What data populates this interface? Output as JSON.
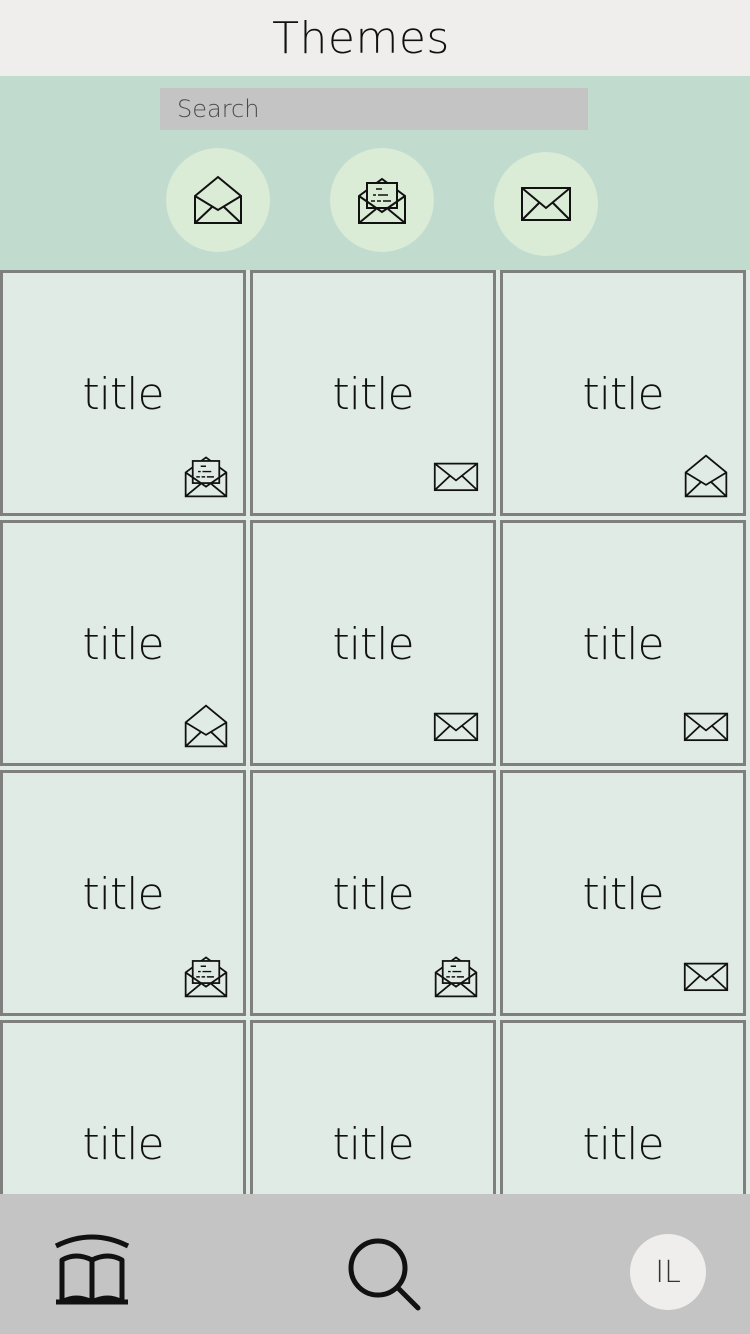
{
  "header": {
    "title": "Themes"
  },
  "search": {
    "placeholder": "Search"
  },
  "filters": [
    {
      "name": "open-envelope-filter",
      "icon": "envelope-open-icon"
    },
    {
      "name": "open-letter-filter",
      "icon": "envelope-letter-icon"
    },
    {
      "name": "closed-envelope-filter",
      "icon": "envelope-closed-icon"
    }
  ],
  "tiles": [
    {
      "title": "title",
      "icon": "envelope-letter-icon"
    },
    {
      "title": "title",
      "icon": "envelope-closed-icon"
    },
    {
      "title": "title",
      "icon": "envelope-open-icon"
    },
    {
      "title": "title",
      "icon": "envelope-open-icon"
    },
    {
      "title": "title",
      "icon": "envelope-closed-icon"
    },
    {
      "title": "title",
      "icon": "envelope-closed-icon"
    },
    {
      "title": "title",
      "icon": "envelope-letter-icon"
    },
    {
      "title": "title",
      "icon": "envelope-letter-icon"
    },
    {
      "title": "title",
      "icon": "envelope-closed-icon"
    },
    {
      "title": "title",
      "icon": ""
    },
    {
      "title": "title",
      "icon": ""
    },
    {
      "title": "title",
      "icon": ""
    }
  ],
  "bottom_nav": {
    "library_icon": "book-icon",
    "search_icon": "search-icon",
    "avatar_initials": "IL"
  },
  "colors": {
    "header_bg": "#efeeec",
    "filter_bar_bg": "#c1dbcf",
    "filter_button_bg": "#daebd6",
    "tile_bg": "#e1ebe6",
    "tile_border": "#7f7f7f",
    "nav_bg": "#c4c4c4"
  }
}
